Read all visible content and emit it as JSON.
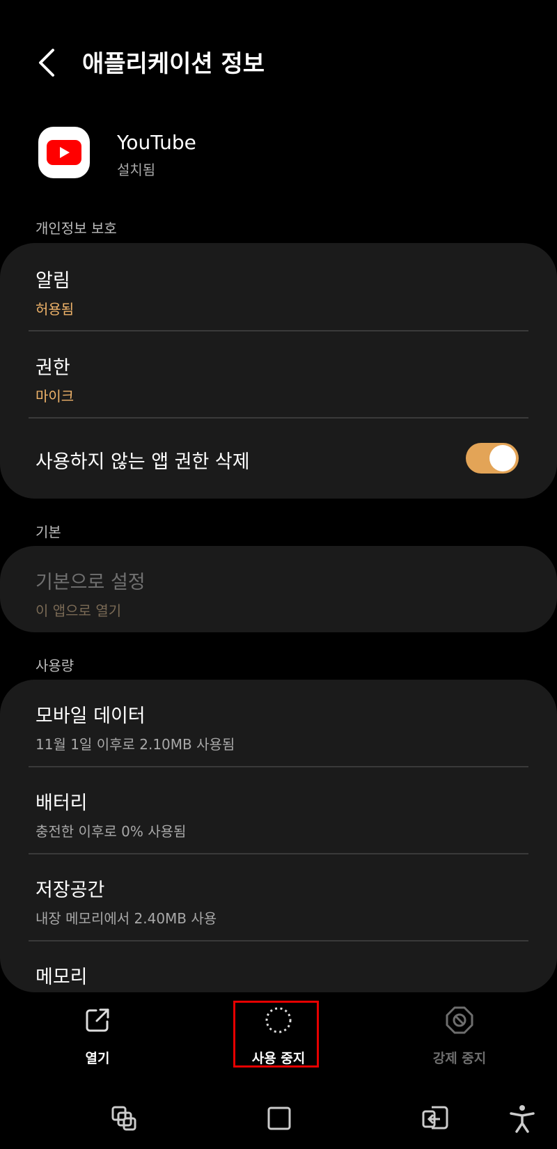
{
  "header": {
    "title": "애플리케이션 정보"
  },
  "app": {
    "name": "YouTube",
    "status": "설치됨"
  },
  "privacy": {
    "section_label": "개인정보 보호",
    "notifications": {
      "title": "알림",
      "sub": "허용됨"
    },
    "permissions": {
      "title": "권한",
      "sub": "마이크"
    },
    "remove_unused": {
      "title": "사용하지 않는 앱 권한 삭제",
      "toggle_on": true
    }
  },
  "defaults": {
    "section_label": "기본",
    "set_default": {
      "title": "기본으로 설정",
      "sub": "이 앱으로 열기"
    }
  },
  "usage": {
    "section_label": "사용량",
    "mobile_data": {
      "title": "모바일 데이터",
      "sub": "11월 1일 이후로 2.10MB 사용됨"
    },
    "battery": {
      "title": "배터리",
      "sub": "충전한 이후로 0% 사용됨"
    },
    "storage": {
      "title": "저장공간",
      "sub": "내장 메모리에서 2.40MB 사용"
    },
    "memory": {
      "title": "메모리"
    }
  },
  "actions": {
    "open": "열기",
    "disable": "사용 중지",
    "force_stop": "강제 중지"
  },
  "colors": {
    "accent": "#e3a457",
    "highlight": "#e60000",
    "youtube_red": "#ff0000"
  }
}
